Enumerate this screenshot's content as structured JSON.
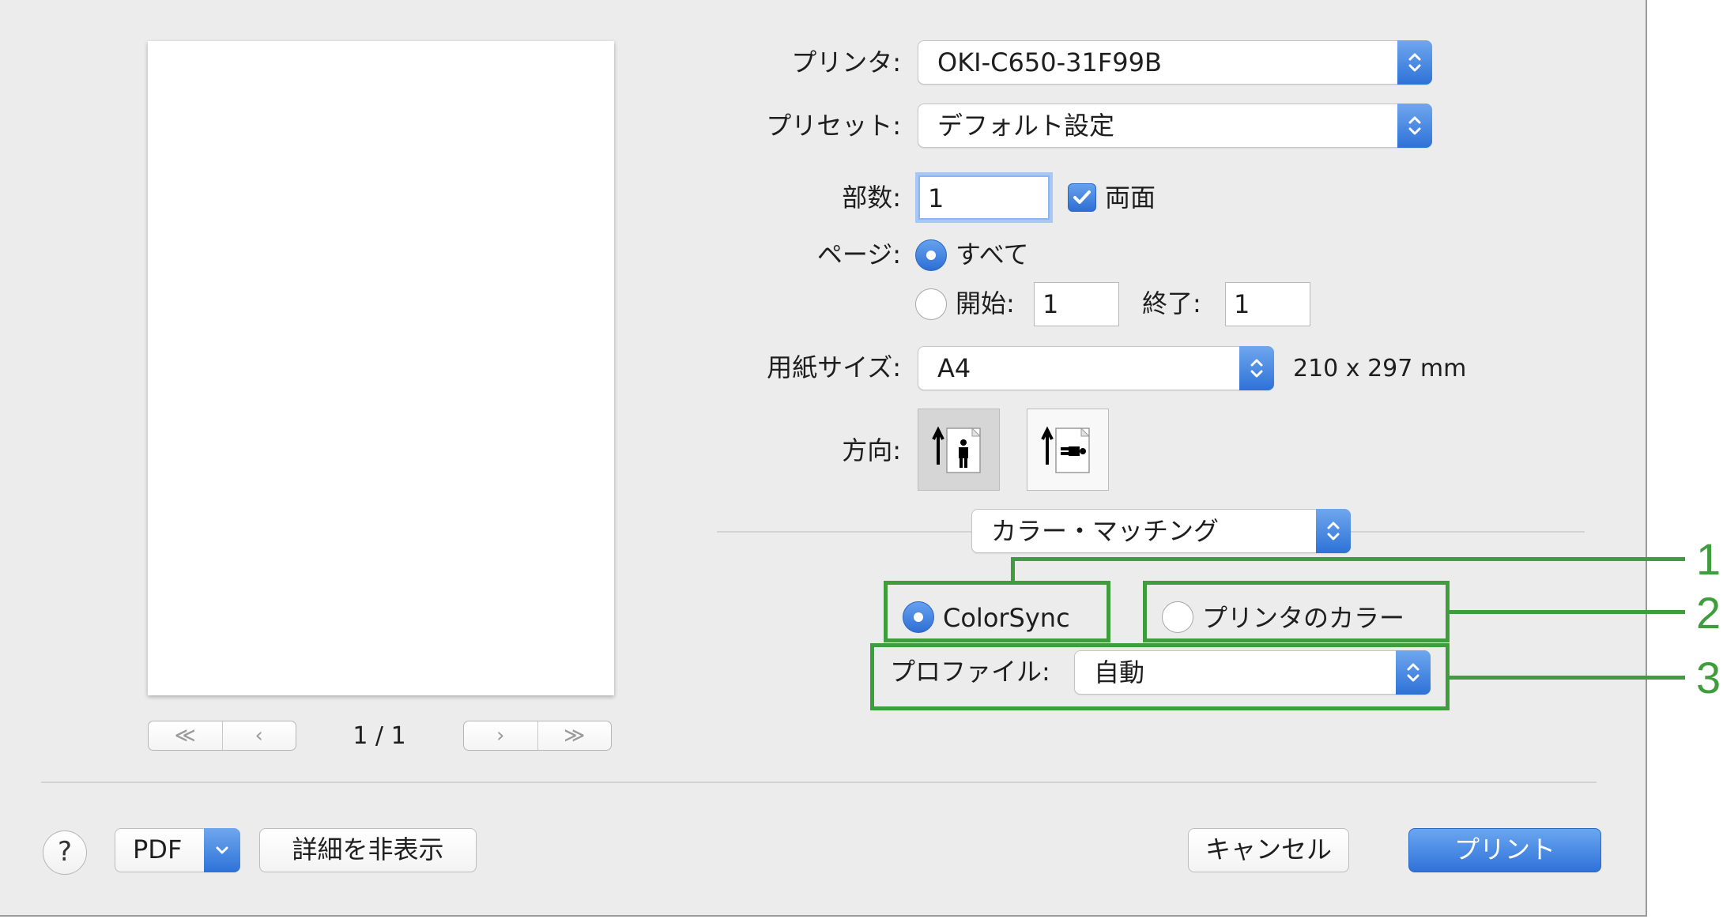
{
  "preview": {
    "page_indicator": "1 / 1",
    "nav_first": "≪",
    "nav_prev": "‹",
    "nav_next": "›",
    "nav_last": "≫"
  },
  "printer": {
    "label": "プリンタ:",
    "value": "OKI-C650-31F99B"
  },
  "preset": {
    "label": "プリセット:",
    "value": "デフォルト設定"
  },
  "copies": {
    "label": "部数:",
    "value": "1",
    "duplex_label": "両面",
    "duplex_checked": true
  },
  "pages": {
    "label": "ページ:",
    "all_label": "すべて",
    "from_label": "開始:",
    "from_value": "1",
    "to_label": "終了:",
    "to_value": "1",
    "selected": "all"
  },
  "paper_size": {
    "label": "用紙サイズ:",
    "value": "A4",
    "dimensions": "210 x 297 mm"
  },
  "orientation": {
    "label": "方向:",
    "selected": "portrait"
  },
  "panel_select": {
    "value": "カラー・マッチング"
  },
  "color_matching": {
    "colorsync_label": "ColorSync",
    "printer_color_label": "プリンタのカラー",
    "selected": "ColorSync",
    "profile_label": "プロファイル:",
    "profile_value": "自動"
  },
  "callouts": [
    "1",
    "2",
    "3"
  ],
  "footer": {
    "help": "?",
    "pdf": "PDF",
    "hide_details": "詳細を非表示",
    "cancel": "キャンセル",
    "print": "プリント"
  },
  "colors": {
    "accent": "#2f72d9",
    "annotation_green": "#3f9d3d",
    "dialog_bg": "#ececec"
  }
}
